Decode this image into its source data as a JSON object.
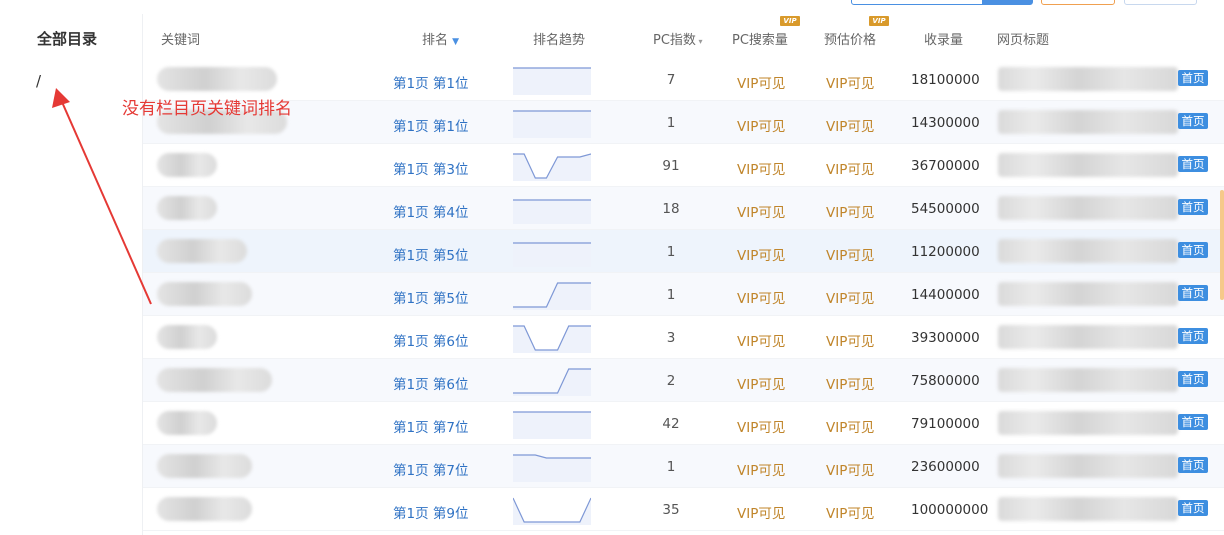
{
  "sidebar": {
    "title": "全部目录",
    "items": [
      {
        "label": "/"
      }
    ]
  },
  "annotation": {
    "text": "没有栏目页关键词排名",
    "color": "#e53935"
  },
  "columns": {
    "keyword": "关键词",
    "rank": "排名",
    "trend": "排名趋势",
    "pc_index": "PC指数",
    "pc_search": "PC搜索量",
    "price": "预估价格",
    "indexed": "收录量",
    "page_title": "网页标题",
    "vip_badge": "VIP"
  },
  "colors": {
    "rank_link": "#2f72c4",
    "vip_text": "#c0852a",
    "home_tag": "#3d8ee0",
    "sparkline": "#7e98d6"
  },
  "rows": [
    {
      "rank": "第1页 第1位",
      "trend": [
        1,
        1,
        1,
        1,
        1,
        1,
        1,
        1
      ],
      "pc_index": "7",
      "pc_search": "VIP可见",
      "price": "VIP可见",
      "indexed": "18100000",
      "tag": "首页"
    },
    {
      "rank": "第1页 第1位",
      "trend": [
        1,
        1,
        1,
        1,
        1,
        1,
        1,
        1
      ],
      "pc_index": "1",
      "pc_search": "VIP可见",
      "price": "VIP可见",
      "indexed": "14300000",
      "tag": "首页"
    },
    {
      "rank": "第1页 第3位",
      "trend": [
        1,
        1,
        9,
        9,
        2,
        2,
        2,
        1
      ],
      "pc_index": "91",
      "pc_search": "VIP可见",
      "price": "VIP可见",
      "indexed": "36700000",
      "tag": "首页"
    },
    {
      "rank": "第1页 第4位",
      "trend": [
        2,
        2,
        2,
        2,
        2,
        2,
        2,
        2
      ],
      "pc_index": "18",
      "pc_search": "VIP可见",
      "price": "VIP可见",
      "indexed": "54500000",
      "tag": "首页"
    },
    {
      "rank": "第1页 第5位",
      "trend": [
        2,
        2,
        2,
        2,
        2,
        2,
        2,
        2
      ],
      "pc_index": "1",
      "pc_search": "VIP可见",
      "price": "VIP可见",
      "indexed": "11200000",
      "tag": "首页"
    },
    {
      "rank": "第1页 第5位",
      "trend": [
        9,
        9,
        9,
        9,
        1,
        1,
        1,
        1
      ],
      "pc_index": "1",
      "pc_search": "VIP可见",
      "price": "VIP可见",
      "indexed": "14400000",
      "tag": "首页"
    },
    {
      "rank": "第1页 第6位",
      "trend": [
        1,
        1,
        9,
        9,
        9,
        1,
        1,
        1
      ],
      "pc_index": "3",
      "pc_search": "VIP可见",
      "price": "VIP可见",
      "indexed": "39300000",
      "tag": "首页"
    },
    {
      "rank": "第1页 第6位",
      "trend": [
        9,
        9,
        9,
        9,
        9,
        1,
        1,
        1
      ],
      "pc_index": "2",
      "pc_search": "VIP可见",
      "price": "VIP可见",
      "indexed": "75800000",
      "tag": "首页"
    },
    {
      "rank": "第1页 第7位",
      "trend": [
        1,
        1,
        1,
        1,
        1,
        1,
        1,
        1
      ],
      "pc_index": "42",
      "pc_search": "VIP可见",
      "price": "VIP可见",
      "indexed": "79100000",
      "tag": "首页"
    },
    {
      "rank": "第1页 第7位",
      "trend": [
        1,
        1,
        1,
        2,
        2,
        2,
        2,
        2
      ],
      "pc_index": "1",
      "pc_search": "VIP可见",
      "price": "VIP可见",
      "indexed": "23600000",
      "tag": "首页"
    },
    {
      "rank": "第1页 第9位",
      "trend": [
        1,
        9,
        9,
        9,
        9,
        9,
        9,
        1
      ],
      "pc_index": "35",
      "pc_search": "VIP可见",
      "price": "VIP可见",
      "indexed": "100000000",
      "tag": "首页"
    }
  ]
}
